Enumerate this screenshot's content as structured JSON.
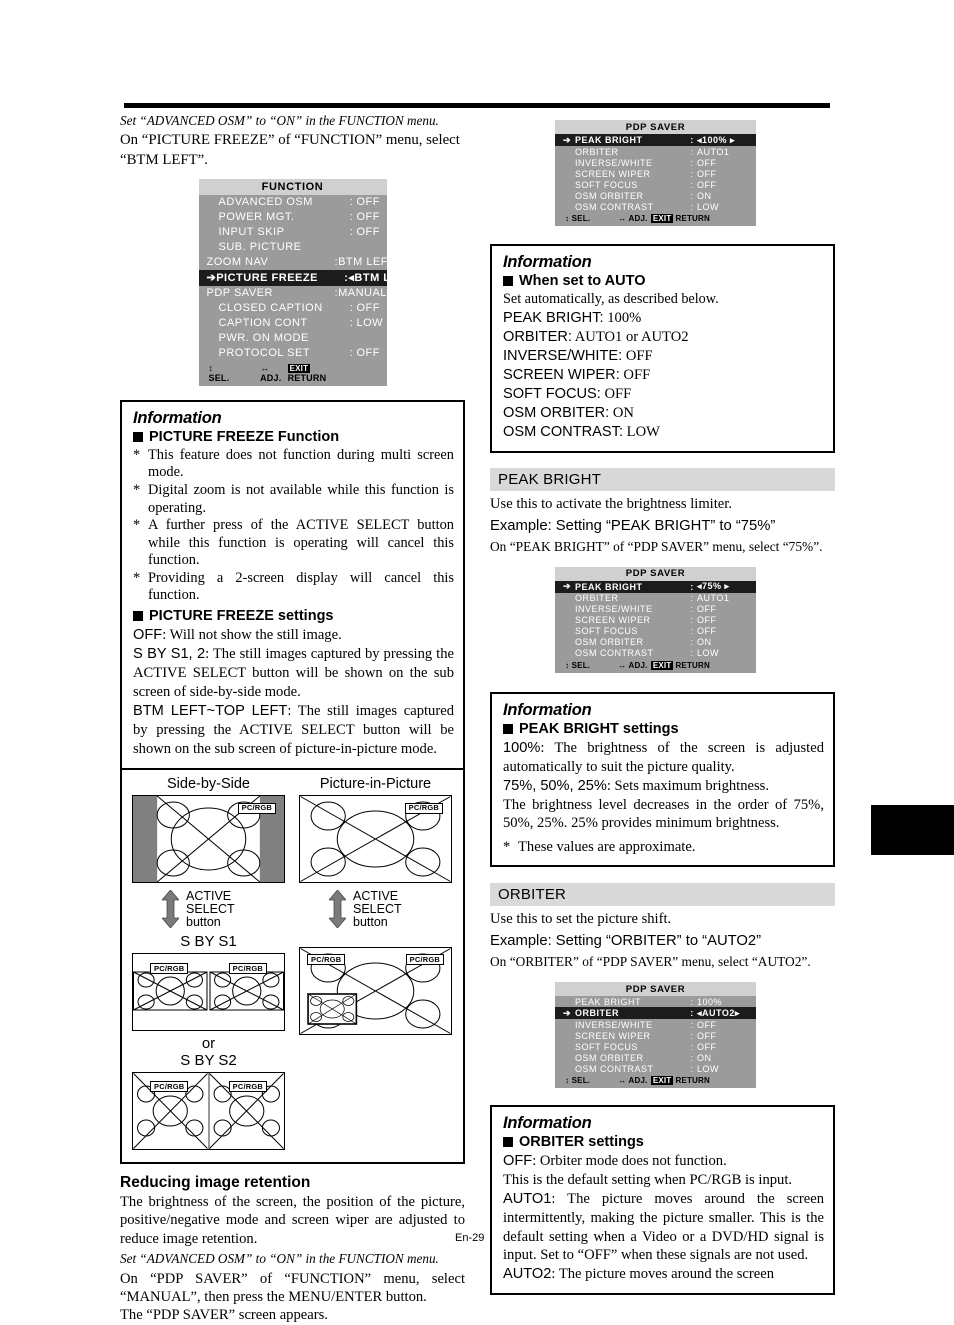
{
  "page": {
    "folio": "En-29"
  },
  "left": {
    "intro_italic": "Set “ADVANCED OSM” to “ON” in the FUNCTION menu.",
    "intro_body": "On “PICTURE FREEZE” of “FUNCTION” menu, select “BTM LEFT”.",
    "function_menu": {
      "title": "FUNCTION",
      "rows": [
        {
          "arrow": "",
          "label": "ADVANCED OSM",
          "colon": ":",
          "value": "OFF",
          "selected": false
        },
        {
          "arrow": "",
          "label": "POWER MGT.",
          "colon": ":",
          "value": "OFF",
          "selected": false
        },
        {
          "arrow": "",
          "label": "INPUT SKIP",
          "colon": ":",
          "value": "OFF",
          "selected": false
        },
        {
          "arrow": "",
          "label": "SUB. PICTURE",
          "colon": "",
          "value": "",
          "selected": false
        },
        {
          "arrow": "",
          "label": "ZOOM NAV",
          "colon": ":",
          "value": "BTM LEFT",
          "selected": false
        },
        {
          "arrow": "➔",
          "label": "PICTURE FREEZE",
          "colon": ":",
          "value": "◂BTM LEFT ▸",
          "selected": true
        },
        {
          "arrow": "",
          "label": "PDP SAVER",
          "colon": ":",
          "value": "MANUAL",
          "selected": false
        },
        {
          "arrow": "",
          "label": "CLOSED CAPTION",
          "colon": ":",
          "value": "OFF",
          "selected": false
        },
        {
          "arrow": "",
          "label": "CAPTION CONT",
          "colon": ":",
          "value": "LOW",
          "selected": false
        },
        {
          "arrow": "",
          "label": "PWR. ON MODE",
          "colon": "",
          "value": "",
          "selected": false
        },
        {
          "arrow": "",
          "label": "PROTOCOL SET",
          "colon": ":",
          "value": "OFF",
          "selected": false
        }
      ],
      "foot_sel": "↕ SEL.",
      "foot_adj": "↔ ADJ.",
      "foot_exit": "EXIT",
      "foot_return": "RETURN"
    },
    "info1": {
      "title": "Information",
      "sub1": "PICTURE FREEZE Function",
      "notes": [
        "This feature does not function during multi screen mode.",
        "Digital zoom is not available while this function is operating.",
        "A further press of the ACTIVE SELECT button while this function is operating will cancel this function.",
        "Providing a 2-screen display will cancel this function."
      ],
      "sub2": "PICTURE FREEZE settings",
      "settings": [
        {
          "key": "OFF",
          "text": ": Will not show the still image."
        },
        {
          "key": "S BY S1, 2",
          "text": ": The still images captured by pressing the ACTIVE SELECT button will be shown on the sub screen of side-by-side mode."
        },
        {
          "key": "BTM LEFT~TOP LEFT",
          "text": ": The still images captured by pressing the ACTIVE SELECT button will be shown on the sub screen of picture-in-picture mode."
        }
      ]
    },
    "diagram": {
      "cap_left": "Side-by-Side",
      "cap_right": "Picture-in-Picture",
      "active_select": [
        "ACTIVE",
        "SELECT",
        "button"
      ],
      "label_sbys1": "S BY S1",
      "label_or": "or",
      "label_sbys2": "S BY S2",
      "tag": "PC/RGB"
    },
    "retention": {
      "heading": "Reducing image retention",
      "p1": "The brightness of the screen, the position of the picture, positive/negative mode and screen wiper are adjusted to reduce image retention.",
      "p2_italic": "Set “ADVANCED OSM” to “ON” in the FUNCTION menu.",
      "p3": "On “PDP SAVER” of “FUNCTION” menu, select “MANUAL”, then press the MENU/ENTER button.",
      "p4": "The “PDP SAVER” screen appears."
    }
  },
  "right": {
    "menu_top": {
      "title": "PDP SAVER",
      "rows": [
        {
          "arrow": "➔",
          "label": "PEAK BRIGHT",
          "colon": ":",
          "value": "◂100% ▸",
          "selected": true
        },
        {
          "arrow": "",
          "label": "ORBITER",
          "colon": ":",
          "value": "AUTO1",
          "selected": false
        },
        {
          "arrow": "",
          "label": "INVERSE/WHITE",
          "colon": ":",
          "value": "OFF",
          "selected": false
        },
        {
          "arrow": "",
          "label": "SCREEN WIPER",
          "colon": ":",
          "value": "OFF",
          "selected": false
        },
        {
          "arrow": "",
          "label": "SOFT FOCUS",
          "colon": ":",
          "value": "OFF",
          "selected": false
        },
        {
          "arrow": "",
          "label": "OSM ORBITER",
          "colon": ":",
          "value": "ON",
          "selected": false
        },
        {
          "arrow": "",
          "label": "OSM CONTRAST",
          "colon": ":",
          "value": "LOW",
          "selected": false
        }
      ],
      "foot_sel": "↕ SEL.",
      "foot_adj": "↔ ADJ.",
      "foot_exit": "EXIT",
      "foot_return": "RETURN"
    },
    "info_auto": {
      "title": "Information",
      "sub": "When set to AUTO",
      "lead": "Set automatically, as described below.",
      "values": [
        {
          "key": "PEAK BRIGHT:",
          "val": "100%"
        },
        {
          "key": "ORBITER:",
          "val": "AUTO1 or AUTO2"
        },
        {
          "key": "INVERSE/WHITE:",
          "val": "OFF"
        },
        {
          "key": "SCREEN WIPER:",
          "val": "OFF"
        },
        {
          "key": "SOFT FOCUS:",
          "val": "OFF"
        },
        {
          "key": "OSM ORBITER:",
          "val": "ON"
        },
        {
          "key": "OSM CONTRAST:",
          "val": "LOW"
        }
      ]
    },
    "peak_bright": {
      "heading": "PEAK BRIGHT",
      "desc": "Use this to activate the brightness limiter.",
      "example": "Example: Setting “PEAK BRIGHT” to “75%”",
      "instruction": "On “PEAK BRIGHT” of “PDP SAVER” menu, select “75%”."
    },
    "menu_peak": {
      "title": "PDP SAVER",
      "rows": [
        {
          "arrow": "➔",
          "label": "PEAK BRIGHT",
          "colon": ":",
          "value": "◂75% ▸",
          "selected": true
        },
        {
          "arrow": "",
          "label": "ORBITER",
          "colon": ":",
          "value": "AUTO1",
          "selected": false
        },
        {
          "arrow": "",
          "label": "INVERSE/WHITE",
          "colon": ":",
          "value": "OFF",
          "selected": false
        },
        {
          "arrow": "",
          "label": "SCREEN WIPER",
          "colon": ":",
          "value": "OFF",
          "selected": false
        },
        {
          "arrow": "",
          "label": "SOFT FOCUS",
          "colon": ":",
          "value": "OFF",
          "selected": false
        },
        {
          "arrow": "",
          "label": "OSM ORBITER",
          "colon": ":",
          "value": "ON",
          "selected": false
        },
        {
          "arrow": "",
          "label": "OSM CONTRAST",
          "colon": ":",
          "value": "LOW",
          "selected": false
        }
      ],
      "foot_sel": "↕ SEL.",
      "foot_adj": "↔ ADJ.",
      "foot_exit": "EXIT",
      "foot_return": "RETURN"
    },
    "info_peak": {
      "title": "Information",
      "sub": "PEAK BRIGHT settings",
      "p1_key": "100%",
      "p1": ": The brightness of the screen is adjusted automatically to suit the picture quality.",
      "p2_key": "75%, 50%, 25%",
      "p2": ": Sets maximum brightness.",
      "p3": "The brightness level decreases in the order  of 75%, 50%, 25%. 25% provides minimum brightness.",
      "note": "These values are approximate."
    },
    "orbiter": {
      "heading": "ORBITER",
      "desc": "Use this to set the picture shift.",
      "example": "Example: Setting “ORBITER” to “AUTO2”",
      "instruction": "On “ORBITER” of “PDP SAVER” menu, select “AUTO2”."
    },
    "menu_orbiter": {
      "title": "PDP SAVER",
      "rows": [
        {
          "arrow": "",
          "label": "PEAK BRIGHT",
          "colon": ":",
          "value": "100%",
          "selected": false
        },
        {
          "arrow": "➔",
          "label": "ORBITER",
          "colon": ":",
          "value": "◂AUTO2▸",
          "selected": true
        },
        {
          "arrow": "",
          "label": "INVERSE/WHITE",
          "colon": ":",
          "value": "OFF",
          "selected": false
        },
        {
          "arrow": "",
          "label": "SCREEN WIPER",
          "colon": ":",
          "value": "OFF",
          "selected": false
        },
        {
          "arrow": "",
          "label": "SOFT FOCUS",
          "colon": ":",
          "value": "OFF",
          "selected": false
        },
        {
          "arrow": "",
          "label": "OSM ORBITER",
          "colon": ":",
          "value": "ON",
          "selected": false
        },
        {
          "arrow": "",
          "label": "OSM CONTRAST",
          "colon": ":",
          "value": "LOW",
          "selected": false
        }
      ],
      "foot_sel": "↕ SEL.",
      "foot_adj": "↔ ADJ.",
      "foot_exit": "EXIT",
      "foot_return": "RETURN"
    },
    "info_orbiter": {
      "title": "Information",
      "sub": "ORBITER settings",
      "off_key": "OFF",
      "off": ": Orbiter mode does not function.",
      "off2": "This is the default setting when PC/RGB is input.",
      "auto1_key": "AUTO1",
      "auto1": ": The picture moves around the screen intermittently, making the picture smaller. This is the default setting when a Video or a DVD/HD signal is input. Set to “OFF” when these signals are not used.",
      "auto2_key": "AUTO2",
      "auto2": ": The picture moves around the screen"
    }
  }
}
